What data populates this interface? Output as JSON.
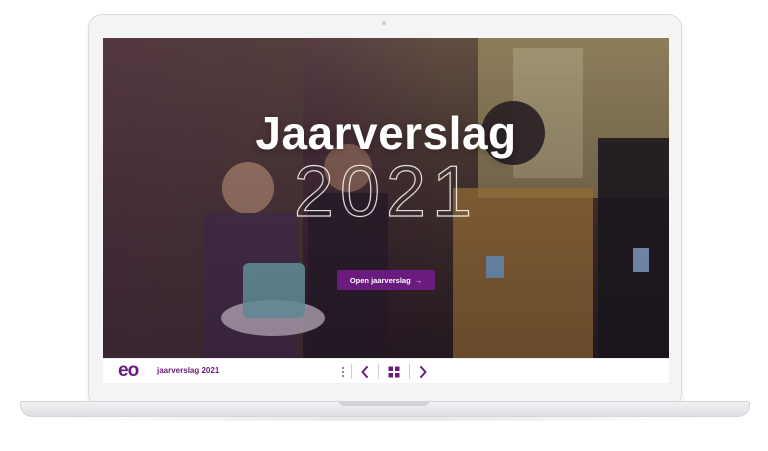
{
  "hero": {
    "title": "Jaarverslag",
    "year": "2021",
    "cta_label": "Open jaarverslag",
    "cta_arrow": "→"
  },
  "footer": {
    "logo_text": "eo",
    "report_label": "jaarverslag 2021"
  },
  "icons": {
    "more": "more-vertical-icon",
    "prev": "chevron-left-icon",
    "grid": "grid-icon",
    "next": "chevron-right-icon"
  },
  "colors": {
    "brand_purple": "#6b1b7d",
    "screen_background": "#111111",
    "device_frame": "#f4f4f6"
  }
}
